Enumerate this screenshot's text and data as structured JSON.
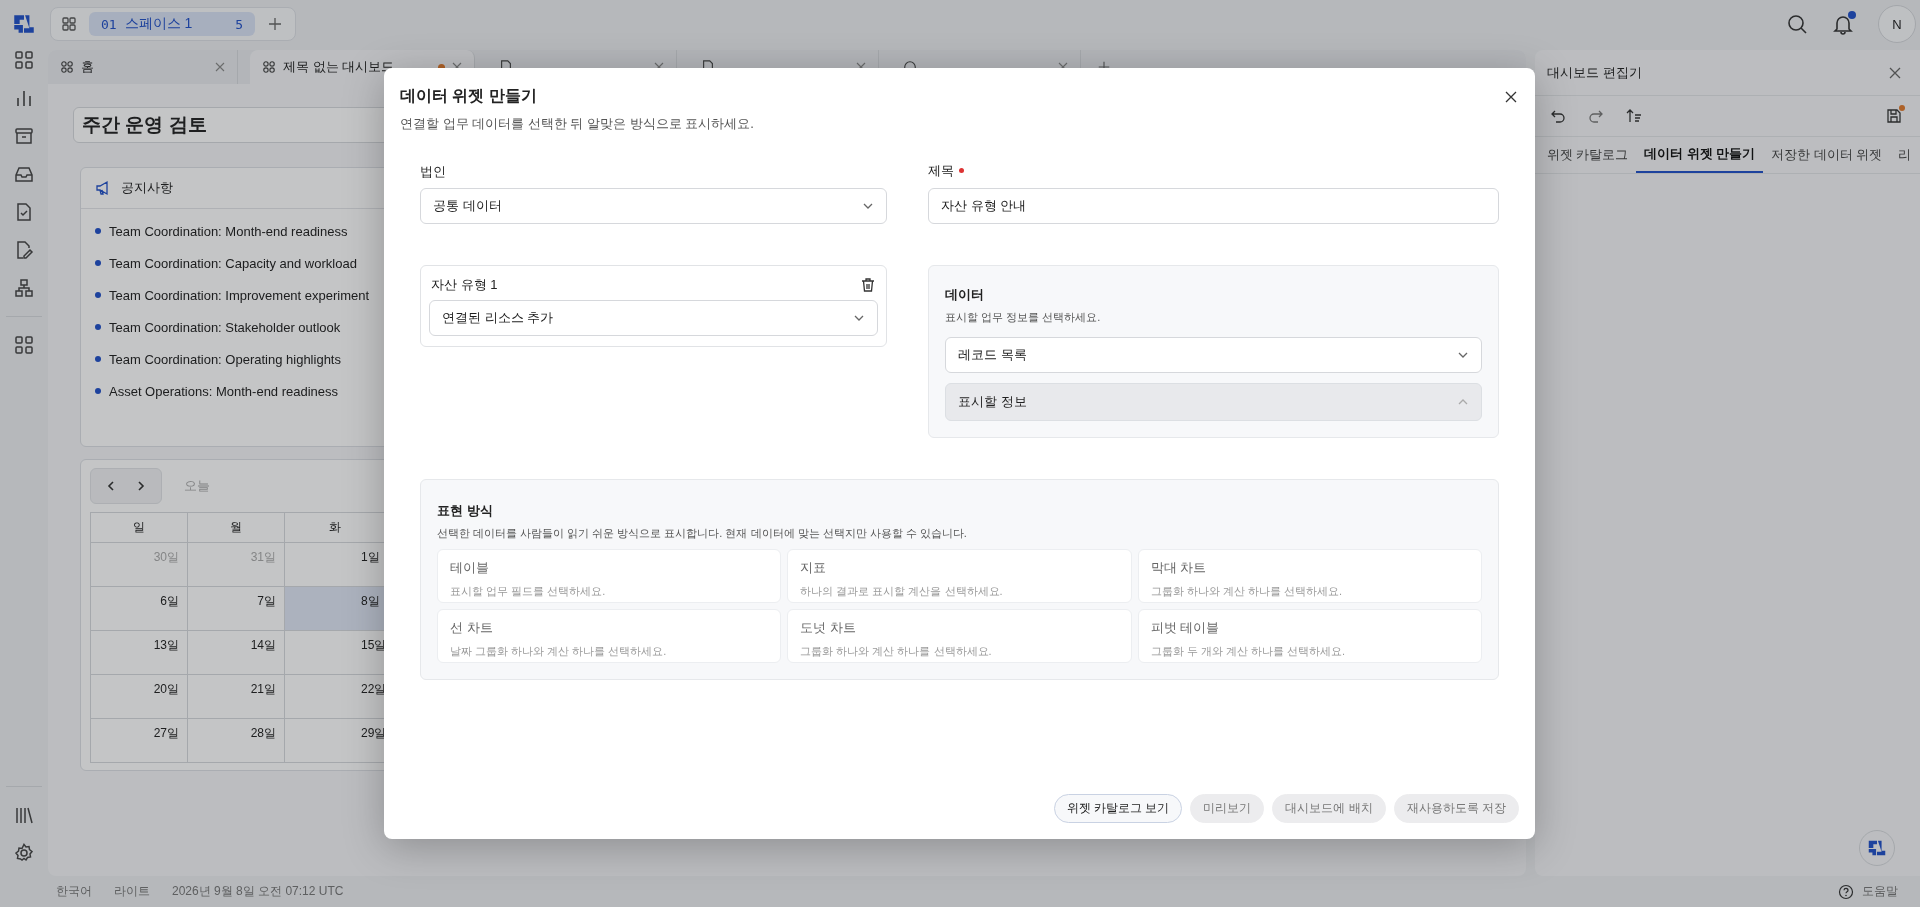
{
  "top_bar": {
    "workspace": {
      "number": "01",
      "name": "스페이스 1",
      "count": "5"
    },
    "notifications": {
      "unread": true
    },
    "avatar": "N"
  },
  "tabs": [
    {
      "kind": "dashboard",
      "label": "홈",
      "selected": false,
      "modified": false
    },
    {
      "kind": "dashboard",
      "label": "제목 없는 대시보드",
      "selected": true,
      "modified": true
    },
    {
      "kind": "document",
      "selected": false,
      "modified": false
    },
    {
      "kind": "document",
      "selected": false,
      "modified": false
    },
    {
      "kind": "inbox",
      "selected": false,
      "modified": false
    }
  ],
  "dashboard": {
    "title": "주간 운영 검토",
    "notice": {
      "title": "공지사항",
      "items": [
        "Team Coordination: Month-end readiness",
        "Team Coordination: Capacity and workload",
        "Team Coordination: Improvement experiment",
        "Team Coordination: Stakeholder outlook",
        "Team Coordination: Operating highlights",
        "Asset Operations: Month-end readiness"
      ]
    },
    "calendar": {
      "today_button": "오늘",
      "weekdays": [
        "일",
        "월",
        "화"
      ],
      "weeks": [
        [
          {
            "label": "30일",
            "muted": true,
            "selected": false
          },
          {
            "label": "31일",
            "muted": true,
            "selected": false
          },
          {
            "label": "1일",
            "muted": false,
            "selected": false
          }
        ],
        [
          {
            "label": "6일",
            "muted": false,
            "selected": false
          },
          {
            "label": "7일",
            "muted": false,
            "selected": false
          },
          {
            "label": "8일",
            "muted": false,
            "selected": true
          }
        ],
        [
          {
            "label": "13일",
            "muted": false,
            "selected": false
          },
          {
            "label": "14일",
            "muted": false,
            "selected": false
          },
          {
            "label": "15일",
            "muted": false,
            "selected": false
          }
        ],
        [
          {
            "label": "20일",
            "muted": false,
            "selected": false
          },
          {
            "label": "21일",
            "muted": false,
            "selected": false
          },
          {
            "label": "22일",
            "muted": false,
            "selected": false
          }
        ],
        [
          {
            "label": "27일",
            "muted": false,
            "selected": false
          },
          {
            "label": "28일",
            "muted": false,
            "selected": false
          },
          {
            "label": "29일",
            "muted": false,
            "selected": false
          }
        ]
      ]
    }
  },
  "editor_panel": {
    "title": "대시보드 편집기",
    "unsaved": true,
    "tabs": [
      {
        "label": "위젯 카탈로그",
        "selected": false
      },
      {
        "label": "데이터 위젯 만들기",
        "selected": true
      },
      {
        "label": "저장한 데이터 위젯",
        "selected": false
      },
      {
        "label": "리",
        "selected": false
      }
    ]
  },
  "modal": {
    "title": "데이터 위젯 만들기",
    "subtitle": "연결할 업무 데이터를 선택한 뒤 알맞은 방식으로 표시하세요.",
    "entity": {
      "label": "법인",
      "value": "공통 데이터"
    },
    "title_field": {
      "label": "제목",
      "required": true,
      "value": "자산 유형 안내"
    },
    "asset_type": {
      "label": "자산 유형 1",
      "value": "연결된 리소스 추가"
    },
    "data": {
      "label": "데이터",
      "hint": "표시할 업무 정보를 선택하세요.",
      "source": "레코드 목록",
      "display_info": {
        "label": "표시할 정보",
        "disabled": true
      }
    },
    "presentation": {
      "title": "표현 방식",
      "description": "선택한 데이터를 사람들이 읽기 쉬운 방식으로 표시합니다. 현재 데이터에 맞는 선택지만 사용할 수 있습니다.",
      "options": [
        {
          "name": "테이블",
          "hint": "표시할 업무 필드를 선택하세요.",
          "disabled": true
        },
        {
          "name": "지표",
          "hint": "하나의 결과로 표시할 계산을 선택하세요.",
          "disabled": true
        },
        {
          "name": "막대 차트",
          "hint": "그룹화 하나와 계산 하나를 선택하세요.",
          "disabled": true
        },
        {
          "name": "선 차트",
          "hint": "날짜 그룹화 하나와 계산 하나를 선택하세요.",
          "disabled": true
        },
        {
          "name": "도넛 차트",
          "hint": "그룹화 하나와 계산 하나를 선택하세요.",
          "disabled": true
        },
        {
          "name": "피벗 테이블",
          "hint": "그룹화 두 개와 계산 하나를 선택하세요.",
          "disabled": true
        }
      ]
    },
    "buttons": [
      {
        "label": "위젯 카탈로그 보기",
        "disabled": false
      },
      {
        "label": "미리보기",
        "disabled": true
      },
      {
        "label": "대시보드에 배치",
        "disabled": true
      },
      {
        "label": "재사용하도록 저장",
        "disabled": true
      }
    ]
  },
  "status_bar": {
    "language": "한국어",
    "theme": "라이트",
    "datetime": "2026년 9월 8일 오전 07:12 UTC",
    "help": "도움말"
  }
}
